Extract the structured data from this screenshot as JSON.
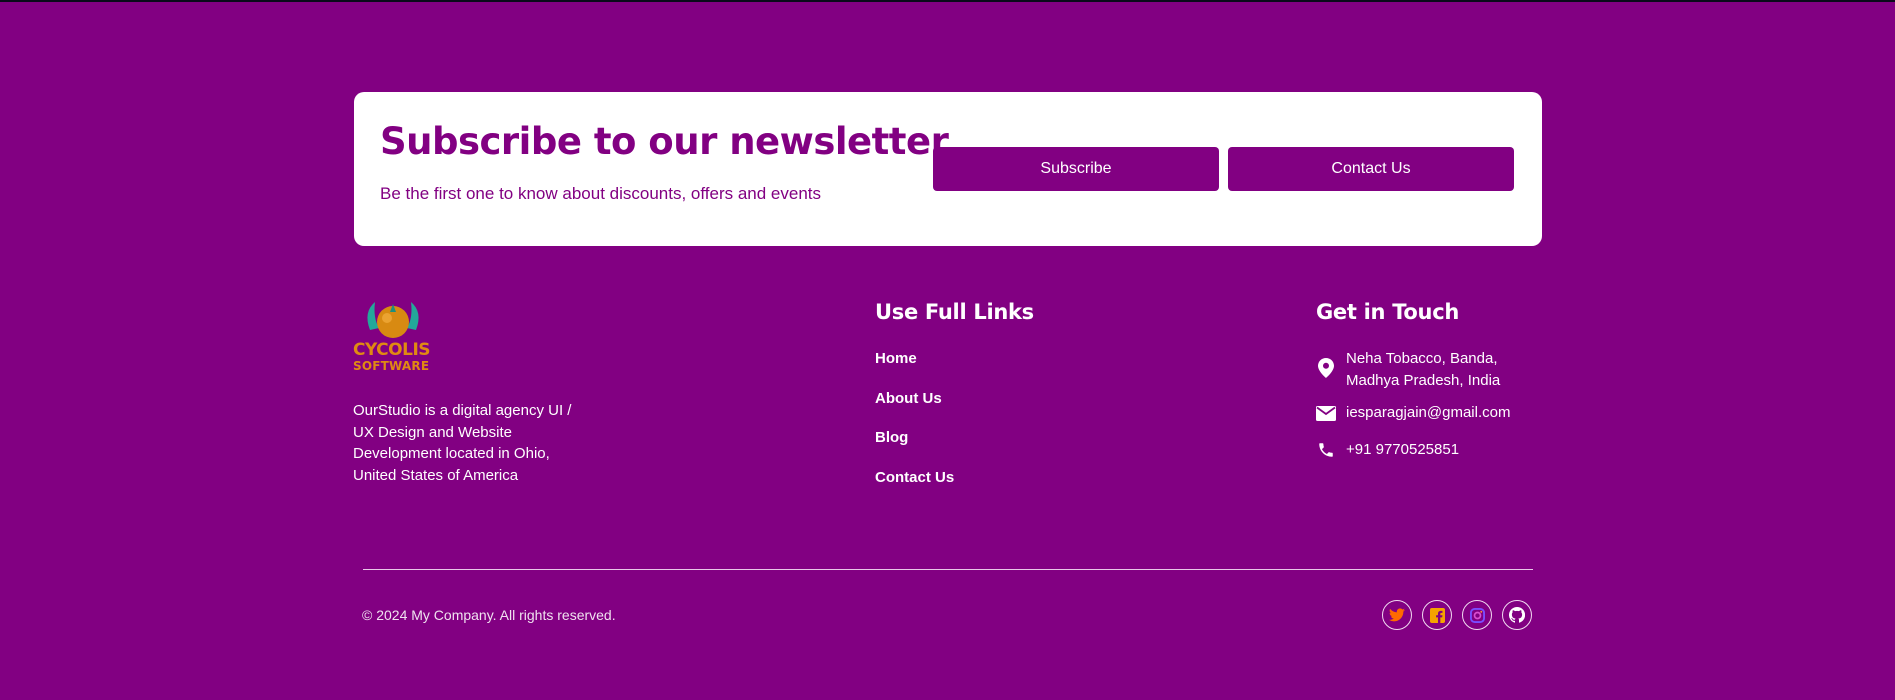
{
  "newsletter": {
    "title": "Subscribe to our newsletter",
    "subtitle": "Be the first one to know about discounts, offers and events",
    "subscribe_label": "Subscribe",
    "contact_label": "Contact Us"
  },
  "brand": {
    "logo_line1": "CYCOLIS",
    "logo_line2": "SOFTWARE",
    "description": "OurStudio is a digital agency UI / UX Design and Website Development located in Ohio, United States of America"
  },
  "links": {
    "title": "Use Full Links",
    "items": [
      "Home",
      "About Us",
      "Blog",
      "Contact Us"
    ]
  },
  "contact": {
    "title": "Get in Touch",
    "address_line1": "Neha Tobacco, Banda,",
    "address_line2": "Madhya Pradesh, India",
    "email": "iesparagjain@gmail.com",
    "phone": "+91 9770525851",
    "icons": [
      "location-pin-icon",
      "mail-icon",
      "phone-icon"
    ]
  },
  "footer": {
    "copyright": "© 2024 My Company. All rights reserved.",
    "social": [
      "twitter-icon",
      "facebook-icon",
      "instagram-icon",
      "github-icon"
    ]
  },
  "colors": {
    "background": "#820082",
    "card": "#ffffff",
    "accent": "#820082",
    "logo": "#e08a12",
    "twitter_icon": "#ff6a00",
    "facebook_icon": "#f5a300",
    "instagram_icon": "#7a4dff"
  }
}
